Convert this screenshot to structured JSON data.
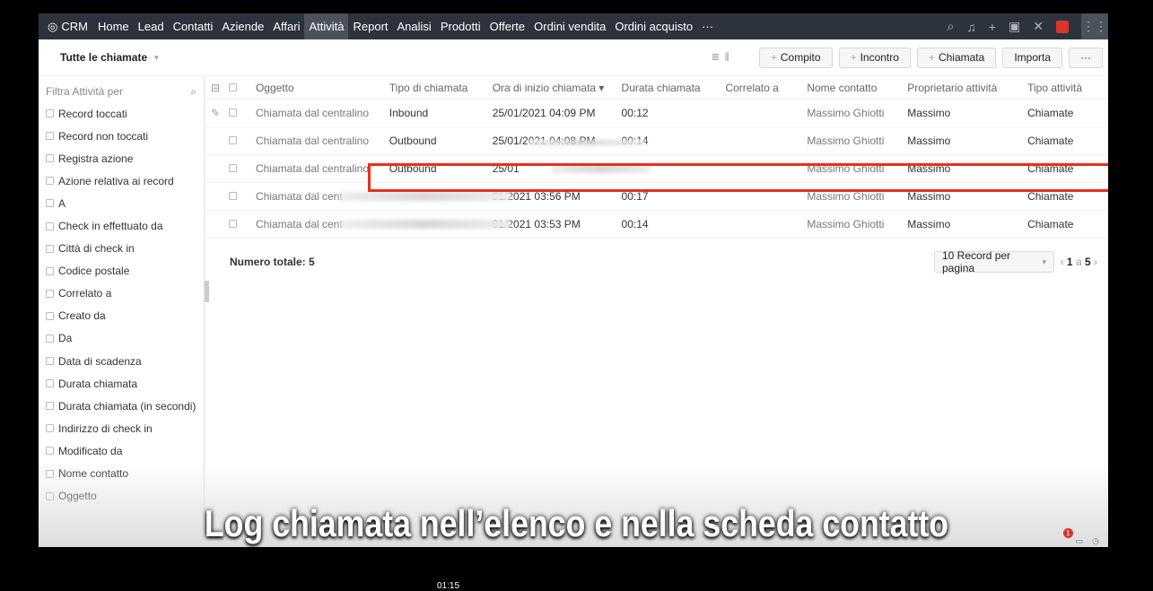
{
  "nav": {
    "brand": "CRM",
    "items": [
      "Home",
      "Lead",
      "Contatti",
      "Aziende",
      "Affari",
      "Attività",
      "Report",
      "Analisi",
      "Prodotti",
      "Offerte",
      "Ordini vendita",
      "Ordini acquisto",
      "···"
    ],
    "active": "Attività"
  },
  "toolbar": {
    "view": "Tutte le chiamate",
    "buttons": [
      "Compito",
      "Incontro",
      "Chiamata"
    ],
    "import": "Importa",
    "more": "···"
  },
  "sidebar": {
    "title": "Filtra Attività per",
    "filters": [
      "Record toccati",
      "Record non toccati",
      "Registra azione",
      "Azione relativa ai record",
      "A",
      "Check in effettuato da",
      "Città di check in",
      "Codice postale",
      "Correlato a",
      "Creato da",
      "Da",
      "Data di scadenza",
      "Durata chiamata",
      "Durata chiamata (in secondi)",
      "Indirizzo di check in",
      "Modificato da",
      "Nome contatto",
      "Oggetto"
    ]
  },
  "table": {
    "headers": [
      "Oggetto",
      "Tipo di chiamata",
      "Ora di inizio chiamata ▾",
      "Durata chiamata",
      "Correlato a",
      "Nome contatto",
      "Proprietario attività",
      "Tipo attività"
    ],
    "rows": [
      [
        "Chiamata dal centralino",
        "Inbound",
        "25/01/2021 04:09 PM",
        "00:12",
        "",
        "Massimo Ghiotti",
        "Massimo",
        "Chiamate"
      ],
      [
        "Chiamata dal centralino",
        "Outbound",
        "25/01/2021 04:08 PM",
        "00:14",
        "",
        "Massimo Ghiotti",
        "Massimo",
        "Chiamate"
      ],
      [
        "Chiamata dal centralino",
        "Outbound",
        "25/01",
        "",
        "",
        "Massimo Ghiotti",
        "Massimo",
        "Chiamate"
      ],
      [
        "Chiamata dal cent",
        "",
        "01/2021 03:56 PM",
        "00:17",
        "",
        "Massimo Ghiotti",
        "Massimo",
        "Chiamate"
      ],
      [
        "Chiamata dal cent",
        "",
        "01/2021 03:53 PM",
        "00:14",
        "",
        "Massimo Ghiotti",
        "Massimo",
        "Chiamate"
      ]
    ],
    "total": "Numero totale: 5",
    "per_page": "10 Record per pagina",
    "pager": {
      "from": "1",
      "sep": "a",
      "to": "5"
    }
  },
  "caption": "Log chiamata nell’elenco e nella scheda contatto",
  "video_time": "01:15",
  "notification_count": "1",
  "colors": {
    "nav": "#2d333c",
    "highlight": "#e5311c"
  }
}
